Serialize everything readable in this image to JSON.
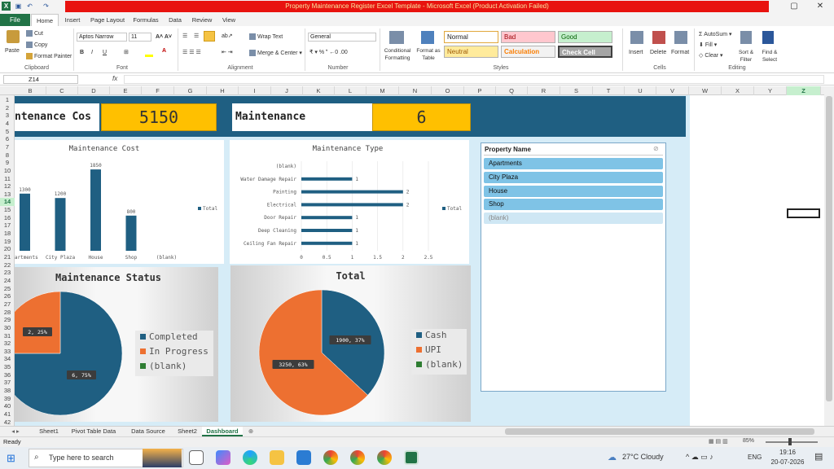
{
  "window": {
    "title": "Property Maintenance Register Excel Template  -  Microsoft Excel (Product Activation Failed)"
  },
  "tabs": [
    "File",
    "Home",
    "Insert",
    "Page Layout",
    "Formulas",
    "Data",
    "Review",
    "View"
  ],
  "ribbon": {
    "clipboard": {
      "paste": "Paste",
      "cut": "Cut",
      "copy": "Copy",
      "painter": "Format Painter",
      "label": "Clipboard"
    },
    "font": {
      "name": "Aptos Narrow",
      "size": "11",
      "label": "Font"
    },
    "alignment": {
      "wrap": "Wrap Text",
      "merge": "Merge & Center",
      "label": "Alignment"
    },
    "number": {
      "format": "General",
      "label": "Number"
    },
    "styles": {
      "conditional": "Conditional Formatting",
      "format_table": "Format as Table",
      "normal": "Normal",
      "bad": "Bad",
      "good": "Good",
      "neutral": "Neutral",
      "calculation": "Calculation",
      "check": "Check Cell",
      "label": "Styles"
    },
    "cells": {
      "insert": "Insert",
      "delete": "Delete",
      "format": "Format",
      "label": "Cells"
    },
    "editing": {
      "autosum": "AutoSum",
      "fill": "Fill",
      "clear": "Clear",
      "sort": "Sort & Filter",
      "find": "Find & Select",
      "label": "Editing"
    }
  },
  "namebox": "Z14",
  "fx": "fx",
  "columns": [
    "B",
    "C",
    "D",
    "E",
    "F",
    "G",
    "H",
    "I",
    "J",
    "K",
    "L",
    "M",
    "N",
    "O",
    "P",
    "Q",
    "R",
    "S",
    "T",
    "U",
    "V",
    "W",
    "X",
    "Y",
    "Z"
  ],
  "rows": [
    "1",
    "2",
    "3",
    "4",
    "5",
    "6",
    "7",
    "8",
    "9",
    "10",
    "11",
    "12",
    "13",
    "14",
    "15",
    "16",
    "17",
    "18",
    "19",
    "20",
    "21",
    "22",
    "23",
    "24",
    "25",
    "26",
    "27",
    "28",
    "29",
    "30",
    "31",
    "32",
    "33",
    "34",
    "35",
    "36",
    "37",
    "38",
    "39",
    "40",
    "41",
    "42"
  ],
  "kpis": [
    {
      "label": "ntenance Cos",
      "value": "5150"
    },
    {
      "label": "Maintenance",
      "value": "6"
    }
  ],
  "charts": {
    "cost": {
      "title": "Maintenance Cost",
      "legend": "Total"
    },
    "type": {
      "title": "Maintenance Type",
      "legend": "Total"
    },
    "status": {
      "title": "Maintenance Status"
    },
    "total": {
      "title": "Total"
    }
  },
  "chart_data": [
    {
      "type": "bar",
      "title": "Maintenance Cost",
      "categories": [
        "Apartments",
        "City Plaza",
        "House",
        "Shop",
        "(blank)"
      ],
      "values": [
        1300,
        1200,
        1850,
        800,
        null
      ],
      "value_labels": [
        "1300",
        "1200",
        "1850",
        "800",
        ""
      ],
      "category_labels": [
        "partments",
        "City Plaza",
        "House",
        "Shop",
        "(blank)"
      ],
      "legend": "Total",
      "ylim": [
        0,
        2000
      ]
    },
    {
      "type": "bar",
      "orientation": "horizontal",
      "title": "Maintenance Type",
      "categories": [
        "(blank)",
        "Water Damage Repair",
        "Painting",
        "Electrical",
        "Door Repair",
        "Deep Cleaning",
        "Ceiling Fan Repair"
      ],
      "values": [
        null,
        1,
        2,
        2,
        1,
        1,
        1
      ],
      "value_labels": [
        "",
        "1",
        "2",
        "2",
        "1",
        "1",
        "1"
      ],
      "xticks": [
        "0",
        "0.5",
        "1",
        "1.5",
        "2",
        "2.5"
      ],
      "xlim": [
        0,
        2.5
      ],
      "legend": "Total"
    },
    {
      "type": "pie",
      "title": "Maintenance Status",
      "labels": [
        "Completed",
        "In Progress",
        "(blank)"
      ],
      "values": [
        6,
        2,
        0
      ],
      "data_labels": [
        "6, 75%",
        "2, 25%",
        ""
      ],
      "colors": [
        "#1f5f82",
        "#ed7031",
        "#2e7d32"
      ]
    },
    {
      "type": "pie",
      "title": "Total",
      "labels": [
        "Cash",
        "UPI",
        "(blank)"
      ],
      "values": [
        1900,
        3250,
        0
      ],
      "data_labels": [
        "1900, 37%",
        "3250, 63%",
        ""
      ],
      "colors": [
        "#1f5f82",
        "#ed7031",
        "#2e7d32"
      ]
    }
  ],
  "slicer": {
    "title": "Property Name",
    "items": [
      "Apartments",
      "City Plaza",
      "House",
      "Shop",
      "(blank)"
    ]
  },
  "sheets": [
    "Sheet1",
    "Pivot Table Data",
    "Data Source",
    "Sheet2",
    "Dashboard"
  ],
  "status": {
    "ready": "Ready",
    "zoom": "85%"
  },
  "taskbar": {
    "search": "Type here to search",
    "weather": "27°C  Cloudy",
    "lang": "ENG",
    "time": "19:16",
    "date": "20-07-2026"
  }
}
